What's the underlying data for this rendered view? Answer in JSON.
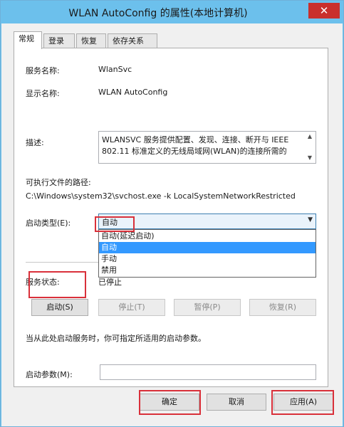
{
  "window": {
    "title": "WLAN AutoConfig 的属性(本地计算机)",
    "close_glyph": "✕"
  },
  "tabs": [
    {
      "label": "常规",
      "active": true
    },
    {
      "label": "登录",
      "active": false
    },
    {
      "label": "恢复",
      "active": false
    },
    {
      "label": "依存关系",
      "active": false
    }
  ],
  "general": {
    "service_name_label": "服务名称:",
    "service_name_value": "WlanSvc",
    "display_name_label": "显示名称:",
    "display_name_value": "WLAN AutoConfig",
    "description_label": "描述:",
    "description_value": "WLANSVC 服务提供配置、发现、连接、断开与 IEEE 802.11 标准定义的无线局域网(WLAN)的连接所需的",
    "exe_path_label": "可执行文件的路径:",
    "exe_path_value": "C:\\Windows\\system32\\svchost.exe -k LocalSystemNetworkRestricted",
    "startup_type_label": "启动类型(E):",
    "startup_type_value": "自动",
    "startup_options": [
      {
        "label": "自动(延迟启动)",
        "selected": false
      },
      {
        "label": "自动",
        "selected": true
      },
      {
        "label": "手动",
        "selected": false
      },
      {
        "label": "禁用",
        "selected": false
      }
    ],
    "service_status_label": "服务状态:",
    "service_status_value": "已停止",
    "buttons": {
      "start": "启动(S)",
      "stop": "停止(T)",
      "pause": "暂停(P)",
      "resume": "恢复(R)"
    },
    "hint_text": "当从此处启动服务时，你可指定所适用的启动参数。",
    "start_params_label": "启动参数(M):",
    "start_params_value": ""
  },
  "footer": {
    "ok": "确定",
    "cancel": "取消",
    "apply": "应用(A)"
  },
  "colors": {
    "titlebar": "#6cc0ec",
    "close_button": "#c9302c",
    "selection": "#3399ff",
    "highlight_annotation": "#d9303a"
  }
}
